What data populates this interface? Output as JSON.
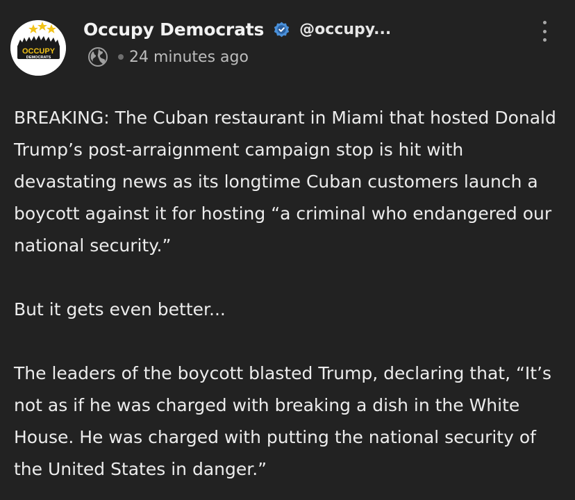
{
  "post": {
    "author": {
      "display_name": "Occupy Democrats",
      "handle": "@occupy...",
      "avatar": {
        "line1": "OCCUPY",
        "line2": "DEMOCRATS",
        "icon": "occupy-democrats-logo"
      },
      "verified_icon": "verified-badge-icon"
    },
    "meta": {
      "visibility_icon": "globe-icon",
      "timestamp": "24 minutes ago"
    },
    "menu_icon": "more-vertical-icon",
    "paragraphs": [
      "BREAKING: The Cuban restaurant in Miami that hosted Donald Trump’s post-arraignment campaign stop is hit with devastating news as its longtime Cuban customers launch a boycott against it for hosting “a criminal who endangered our national security.”",
      "But it gets even better...",
      "The leaders of the boycott blasted Trump, declaring that, “It’s not as if he was charged with breaking a dish in the White House. He was charged with putting the national security of the United States in danger.”"
    ]
  },
  "colors": {
    "background": "#222222",
    "text": "#ececec",
    "verified": "#4a90d9",
    "muted": "#bdbdbd"
  }
}
